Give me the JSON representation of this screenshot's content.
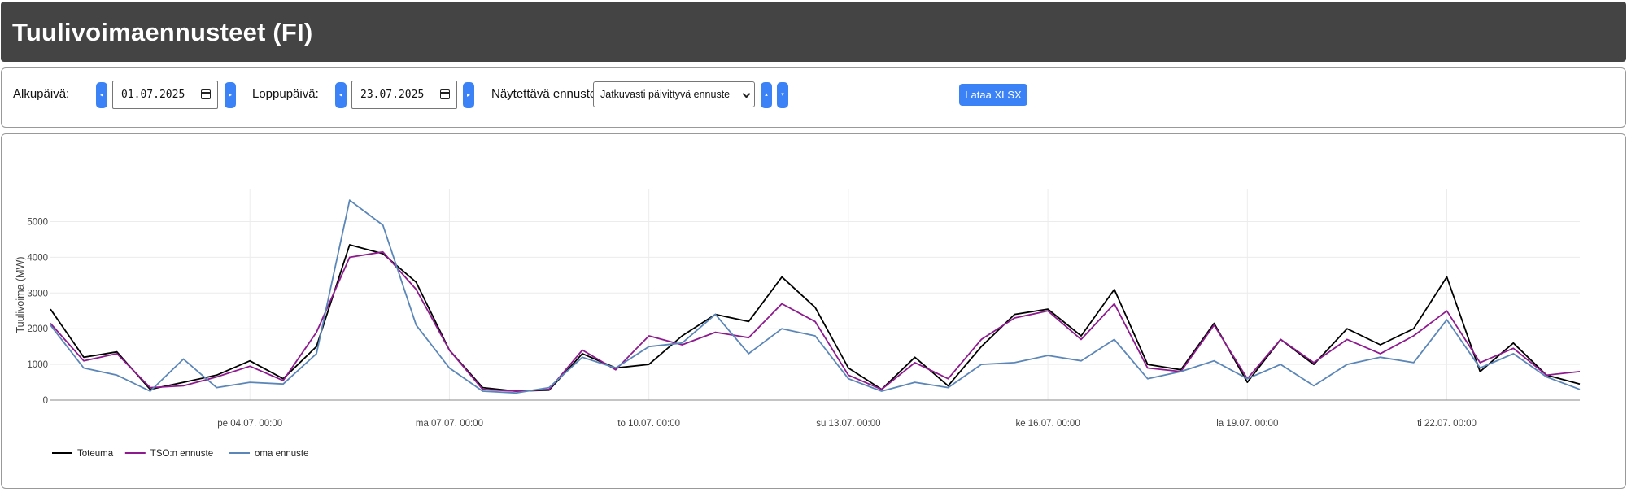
{
  "header": {
    "title": "Tuulivoimaennusteet (FI)"
  },
  "controls": {
    "start_label": "Alkupäivä:",
    "start_value": "01.07.2025",
    "end_label": "Loppupäivä:",
    "end_value": "23.07.2025",
    "forecast_label": "Näytettävä ennuste",
    "forecast_selected": "Jatkuvasti päivittyvä ennuste",
    "download_label": "Lataa XLSX",
    "prev_glyph": "◂",
    "next_glyph": "▸",
    "up_glyph": "▴",
    "down_glyph": "▾"
  },
  "chart_data": {
    "type": "line",
    "title": "",
    "xlabel": "",
    "ylabel": "Tuulivoima (MW)",
    "ylim": [
      0,
      5900
    ],
    "grid": true,
    "legend_position": "bottom-left",
    "yticks": [
      0,
      1000,
      2000,
      3000,
      4000,
      5000
    ],
    "xticks": [
      "pe 04.07. 00:00",
      "ma 07.07. 00:00",
      "to 10.07. 00:00",
      "su 13.07. 00:00",
      "ke 16.07. 00:00",
      "la 19.07. 00:00",
      "ti 22.07. 00:00"
    ],
    "x_days": [
      0,
      0.5,
      1,
      1.5,
      2,
      2.5,
      3,
      3.5,
      4,
      4.5,
      5,
      5.5,
      6,
      6.5,
      7,
      7.5,
      8,
      8.5,
      9,
      9.5,
      10,
      10.5,
      11,
      11.5,
      12,
      12.5,
      13,
      13.5,
      14,
      14.5,
      15,
      15.5,
      16,
      16.5,
      17,
      17.5,
      18,
      18.5,
      19,
      19.5,
      20,
      20.5,
      21,
      21.5,
      22,
      22.5,
      23
    ],
    "series": [
      {
        "name": "Toteuma",
        "color": "#000000",
        "values": [
          2550,
          1200,
          1350,
          300,
          500,
          700,
          1100,
          600,
          1500,
          4350,
          4100,
          3300,
          1400,
          350,
          250,
          280,
          1300,
          900,
          1000,
          1800,
          2400,
          2200,
          3450,
          2600,
          900,
          300,
          1200,
          400,
          1500,
          2400,
          2550,
          1800,
          3100,
          1000,
          850,
          2150,
          500,
          1700,
          1000,
          2000,
          1550,
          2000,
          3450,
          800,
          1600,
          700,
          450
        ]
      },
      {
        "name": "TSO:n ennuste",
        "color": "#8e1b8e",
        "values": [
          2150,
          1100,
          1300,
          350,
          400,
          650,
          950,
          550,
          1900,
          4000,
          4150,
          3100,
          1400,
          300,
          250,
          300,
          1400,
          850,
          1800,
          1550,
          1900,
          1750,
          2700,
          2200,
          700,
          300,
          1050,
          600,
          1700,
          2300,
          2500,
          1700,
          2700,
          900,
          800,
          2100,
          600,
          1700,
          1050,
          1700,
          1300,
          1800,
          2500,
          1050,
          1450,
          700,
          800
        ]
      },
      {
        "name": "oma ennuste",
        "color": "#5b86b8",
        "values": [
          2100,
          900,
          700,
          250,
          1150,
          350,
          500,
          450,
          1300,
          5600,
          4900,
          2100,
          900,
          250,
          200,
          350,
          1200,
          900,
          1500,
          1600,
          2400,
          1300,
          2000,
          1800,
          600,
          250,
          500,
          350,
          1000,
          1050,
          1250,
          1100,
          1700,
          600,
          800,
          1100,
          600,
          1000,
          400,
          1000,
          1200,
          1050,
          2250,
          900,
          1300,
          650,
          300
        ]
      }
    ]
  }
}
